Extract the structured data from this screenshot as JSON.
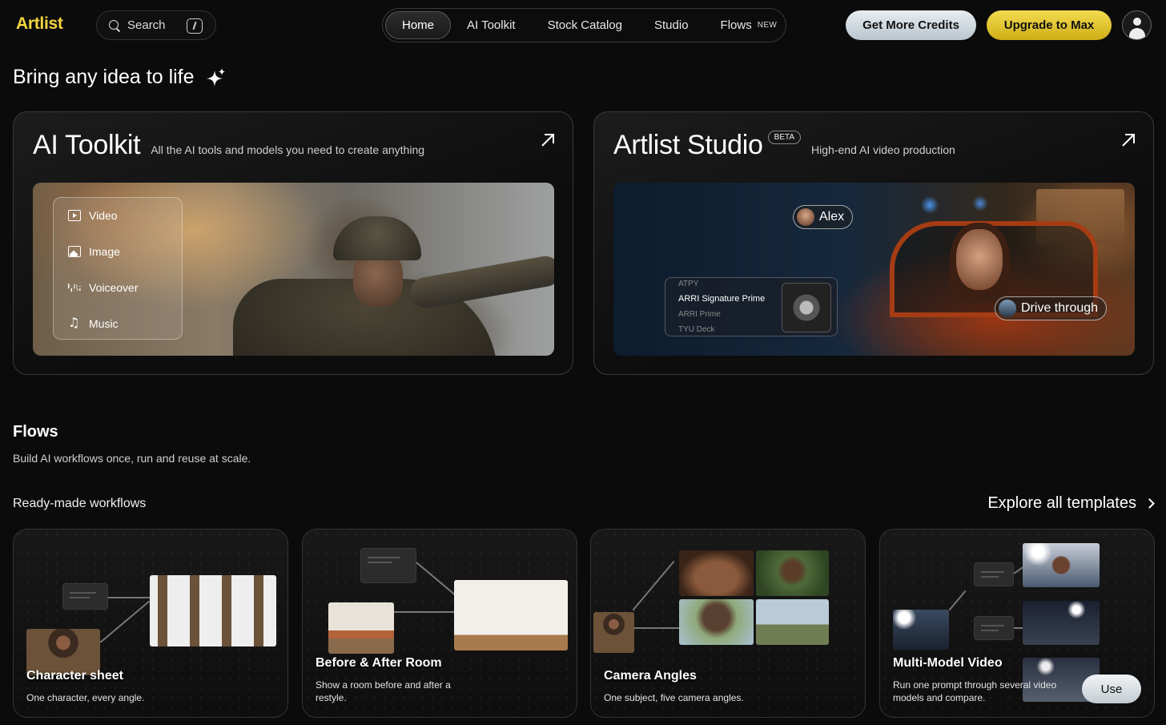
{
  "brand": {
    "logo": "Artlist",
    "accent": "#f5d442"
  },
  "search": {
    "label": "Search"
  },
  "nav": {
    "items": [
      {
        "label": "Home",
        "active": true
      },
      {
        "label": "AI Toolkit"
      },
      {
        "label": "Stock Catalog"
      },
      {
        "label": "Studio"
      },
      {
        "label": "Flows",
        "badge": "NEW"
      }
    ]
  },
  "actions": {
    "credits_label": "Get More Credits",
    "upgrade_label": "Upgrade to Max"
  },
  "hero": {
    "title": "Bring any idea to life"
  },
  "toolkit_card": {
    "title": "AI Toolkit",
    "subtitle": "All the AI tools and models you need to create anything",
    "tools": [
      "Video",
      "Image",
      "Voiceover",
      "Music"
    ]
  },
  "studio_card": {
    "title": "Artlist Studio",
    "badge": "BETA",
    "subtitle": "High-end AI video production",
    "tags": [
      "Alex",
      "Drive through"
    ],
    "lens_options": [
      "ATPY",
      "ARRI Signature Prime",
      "ARRI Prime",
      "TYU Deck"
    ],
    "lens_selected": "ARRI Signature Prime"
  },
  "flows": {
    "title": "Flows",
    "subtitle": "Build AI workflows once, run and reuse at scale.",
    "ready_title": "Ready-made workflows",
    "explore_label": "Explore all templates",
    "workflows": [
      {
        "name": "Character sheet",
        "desc": "One character, every angle."
      },
      {
        "name": "Before & After Room",
        "desc": "Show a room before and after a restyle."
      },
      {
        "name": "Camera Angles",
        "desc": "One subject, five camera angles."
      },
      {
        "name": "Multi-Model Video",
        "desc": "Run one prompt through several video models and compare.",
        "use_label": "Use"
      }
    ]
  }
}
